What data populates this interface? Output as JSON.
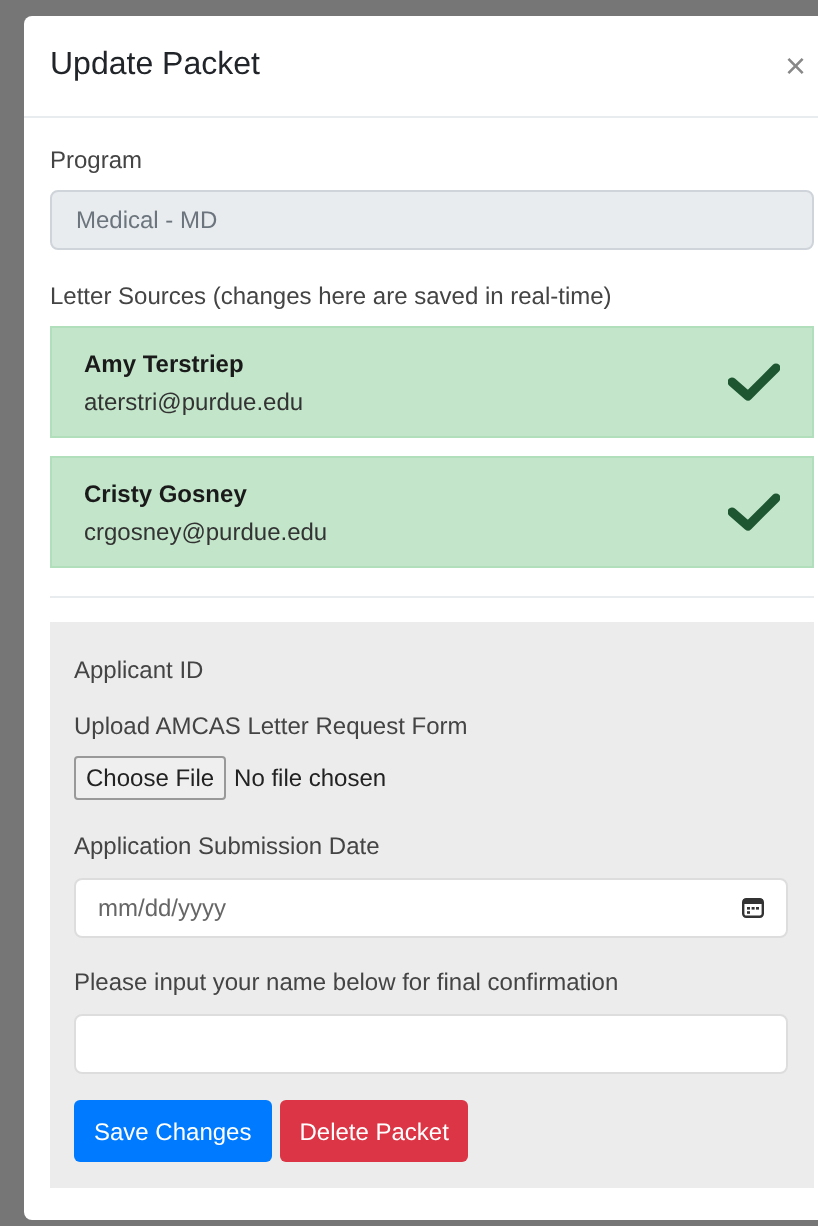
{
  "modal": {
    "title": "Update Packet",
    "close": "×"
  },
  "program": {
    "label": "Program",
    "value": "Medical - MD",
    "disabled": true
  },
  "letter_sources": {
    "label": "Letter Sources (changes here are saved in real-time)",
    "items": [
      {
        "name": "Amy Terstriep",
        "email": "aterstri@purdue.edu",
        "received": true
      },
      {
        "name": "Cristy Gosney",
        "email": "crgosney@purdue.edu",
        "received": true
      }
    ]
  },
  "form": {
    "applicant_id_label": "Applicant ID",
    "upload_label": "Upload AMCAS Letter Request Form",
    "file_button": "Choose File",
    "file_status": "No file chosen",
    "date_label": "Application Submission Date",
    "date_placeholder": "mm/dd/yyyy",
    "name_label": "Please input your name below for final confirmation"
  },
  "buttons": [
    {
      "label": "Save Changes",
      "kind": "primary"
    },
    {
      "label": "Delete Packet",
      "kind": "danger"
    }
  ]
}
